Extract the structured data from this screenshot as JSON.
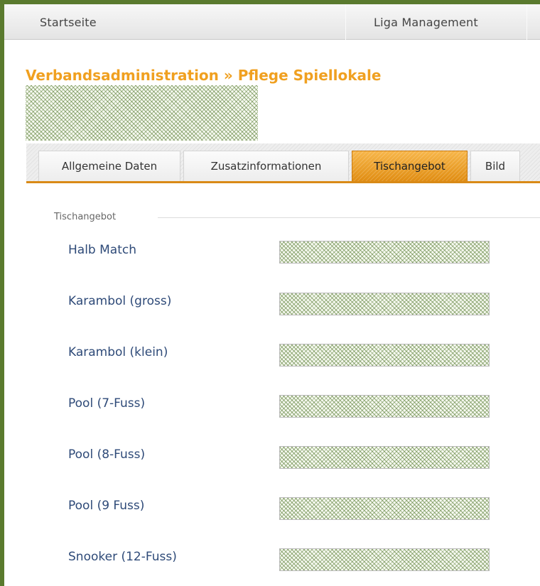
{
  "topnav": {
    "home": "Startseite",
    "liga": "Liga Management"
  },
  "page": {
    "title": "Verbandsadministration » Pflege Spiellokale"
  },
  "tabs": [
    {
      "label": "Allgemeine Daten",
      "active": false
    },
    {
      "label": "Zusatzinformationen",
      "active": false
    },
    {
      "label": "Tischangebot",
      "active": true
    },
    {
      "label": "Bild",
      "active": false
    }
  ],
  "section": {
    "legend": "Tischangebot"
  },
  "tables": [
    {
      "label": "Halb Match"
    },
    {
      "label": "Karambol (gross)"
    },
    {
      "label": "Karambol (klein)"
    },
    {
      "label": "Pool (7-Fuss)"
    },
    {
      "label": "Pool (8-Fuss)"
    },
    {
      "label": "Pool (9 Fuss)"
    },
    {
      "label": "Snooker (12-Fuss)"
    }
  ],
  "colors": {
    "accent": "#f0a020",
    "frame": "#5a7a2e",
    "label": "#2e4a78"
  }
}
